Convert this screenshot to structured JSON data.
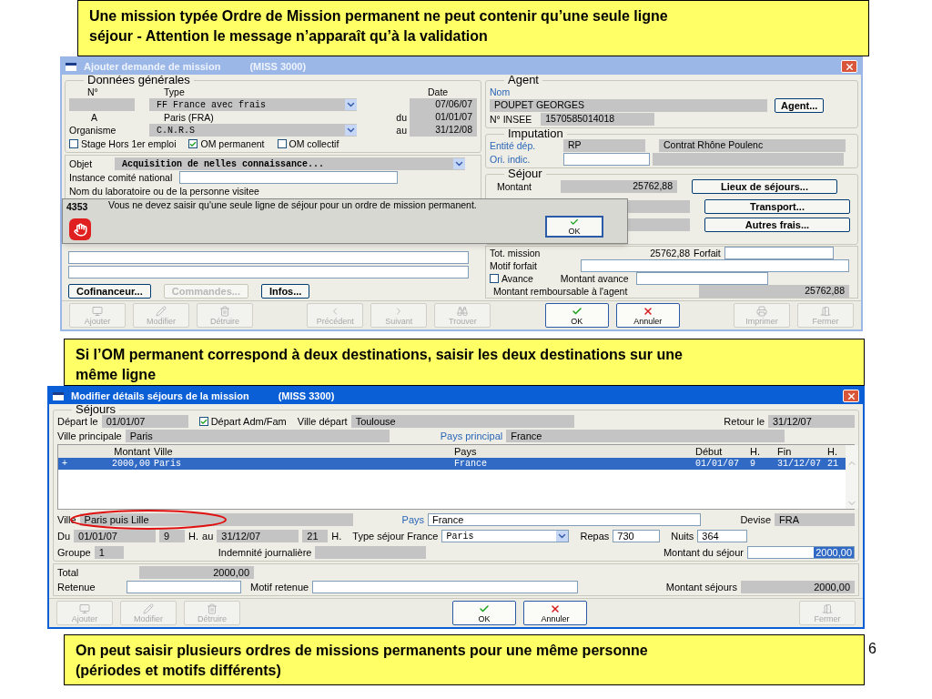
{
  "callout_top": {
    "lines": [
      "Une mission typée Ordre de Mission permanent ne peut contenir qu’une seule ligne",
      "séjour -  Attention le message n’apparaît qu’à la validation"
    ]
  },
  "window_1": {
    "title": "Ajouter demande de mission",
    "code": "(MISS 3000)",
    "general": {
      "heading": "Données générales",
      "col_number": "N°",
      "col_type": "Type",
      "col_date": "Date",
      "type_value": "FF France avec frais",
      "date_value": "07/06/07",
      "a_label": "A",
      "a_value": "Paris (FRA)",
      "du_label": "du",
      "du_value": "01/01/07",
      "organisme_label": "Organisme",
      "organisme_value": "C.N.R.S",
      "au_label": "au",
      "au_value": "31/12/08",
      "checkboxes": [
        {
          "label": "Stage Hors 1er emploi",
          "checked": false
        },
        {
          "label": "OM permanent",
          "checked": true
        },
        {
          "label": "OM collectif",
          "checked": false
        }
      ],
      "objet_label": "Objet",
      "objet_value": "Acquisition de nelles connaissance...",
      "instance_label": "Instance comité national",
      "laboratoire_label": "Nom du laboratoire ou de la personne visitee"
    },
    "agent": {
      "heading": "Agent",
      "nom_label": "Nom",
      "nom_value": "POUPET GEORGES",
      "button": "Agent...",
      "insee_label": "N° INSEE",
      "insee_value": "1570585014018"
    },
    "imputation": {
      "heading": "Imputation",
      "entite_label": "Entité dép.",
      "entite_value": "RP",
      "contrat": "Contrat Rhône Poulenc",
      "ori_label": "Ori. indic."
    },
    "sejour": {
      "heading": "Séjour",
      "montant_label": "Montant",
      "montant_value": "25762,88",
      "buttons": [
        "Lieux de séjours...",
        "Transport...",
        "Autres frais..."
      ],
      "tot_label": "Tot. mission",
      "tot_value": "25762,88",
      "forfait_label": "Forfait",
      "motif_label": "Motif forfait",
      "avance": {
        "label": "Avance",
        "checked": false
      },
      "montant_avance_label": "Montant avance",
      "rembourse_label": "Montant remboursable à l'agent",
      "rembourse_value": "25762,88"
    },
    "buttons": [
      {
        "label": "Cofinanceur...",
        "disabled": false
      },
      {
        "label": "Commandes...",
        "disabled": true
      },
      {
        "label": "Infos...",
        "disabled": false
      }
    ],
    "toolbar": [
      {
        "buttons": [
          {
            "label": "Ajouter",
            "kind": "add",
            "disabled": true
          },
          {
            "label": "Modifier",
            "kind": "edit",
            "disabled": true
          },
          {
            "label": "Détruire",
            "kind": "delete",
            "disabled": true
          }
        ]
      },
      {
        "buttons": [
          {
            "label": "Précédent",
            "kind": "prev",
            "disabled": true
          },
          {
            "label": "Suivant",
            "kind": "next",
            "disabled": true
          },
          {
            "label": "Trouver",
            "kind": "find",
            "disabled": true
          }
        ]
      },
      {
        "buttons": [
          {
            "label": "OK",
            "kind": "ok",
            "disabled": false
          },
          {
            "label": "Annuler",
            "kind": "cancel",
            "disabled": false
          }
        ]
      },
      {
        "buttons": [
          {
            "label": "Imprimer",
            "kind": "print",
            "disabled": true
          },
          {
            "label": "Fermer",
            "kind": "close",
            "disabled": true
          }
        ]
      }
    ],
    "alert": {
      "code": "4353",
      "message": "Vous ne devez saisir qu'une seule ligne de séjour pour un ordre de mission permanent.",
      "button": "OK"
    }
  },
  "callout_middle": {
    "lines": [
      "Si l’OM permanent correspond à deux destinations, saisir les deux destinations sur une",
      "même ligne"
    ]
  },
  "window_2": {
    "title": "Modifier détails séjours de la mission",
    "code": "(MISS 3300)",
    "heading": "Séjours",
    "depart_label": "Départ le",
    "depart_value": "01/01/07",
    "adm_fam": {
      "label": "Départ Adm/Fam",
      "checked": true
    },
    "ville_depart_label": "Ville départ",
    "ville_depart_value": "Toulouse",
    "retour_label": "Retour le",
    "retour_value": "31/12/07",
    "ville_principale_label": "Ville principale",
    "ville_principale_value": "Paris",
    "pays_principal_label": "Pays principal",
    "pays_principal_value": "France",
    "table": {
      "columns": [
        "Montant",
        "Ville",
        "Pays",
        "Début",
        "H.",
        "Fin",
        "H."
      ],
      "rows": [
        {
          "marker": "+",
          "cells": [
            "2000,00",
            "Paris",
            "France",
            "01/01/07",
            "9",
            "31/12/07",
            "21"
          ],
          "selected": true
        }
      ]
    },
    "ville_label": "Ville",
    "ville_value": "Paris puis Lille",
    "pays_label": "Pays",
    "pays_value": "France",
    "devise_label": "Devise",
    "devise_value": "FRA",
    "du_label": "Du",
    "du_value": "01/01/07",
    "du_hour": "9",
    "h_label_1": "H.",
    "au_label": "au",
    "au_value": "31/12/07",
    "au_hour": "21",
    "h_label_2": "H.",
    "type_label": "Type séjour France",
    "type_value": "Paris",
    "repas_label": "Repas",
    "repas_value": "730",
    "nuits_label": "Nuits",
    "nuits_value": "364",
    "groupe_label": "Groupe",
    "groupe_value": "1",
    "indemnite_label": "Indemnité journalière",
    "montant_sejour_label": "Montant du séjour",
    "montant_sejour_value": "2000,00",
    "montant_sejour_selected": true,
    "total_label": "Total",
    "total_value": "2000,00",
    "retenue_label": "Retenue",
    "motif_retenue_label": "Motif retenue",
    "montant_sejours_label": "Montant séjours",
    "montant_sejours_value": "2000,00",
    "toolbar": [
      {
        "buttons": [
          {
            "label": "Ajouter",
            "kind": "add",
            "disabled": true
          },
          {
            "label": "Modifier",
            "kind": "edit",
            "disabled": true
          },
          {
            "label": "Détruire",
            "kind": "delete",
            "disabled": true
          }
        ]
      },
      {
        "buttons": [
          {
            "label": "OK",
            "kind": "ok",
            "disabled": false
          },
          {
            "label": "Annuler",
            "kind": "cancel",
            "disabled": false
          }
        ]
      },
      {
        "buttons": [
          {
            "label": "Fermer",
            "kind": "close",
            "disabled": true
          }
        ]
      }
    ]
  },
  "callout_bottom": {
    "lines": [
      "On peut saisir plusieurs ordres de missions permanents pour une même personne",
      "(périodes et motifs différents)"
    ]
  },
  "page_number": "6"
}
